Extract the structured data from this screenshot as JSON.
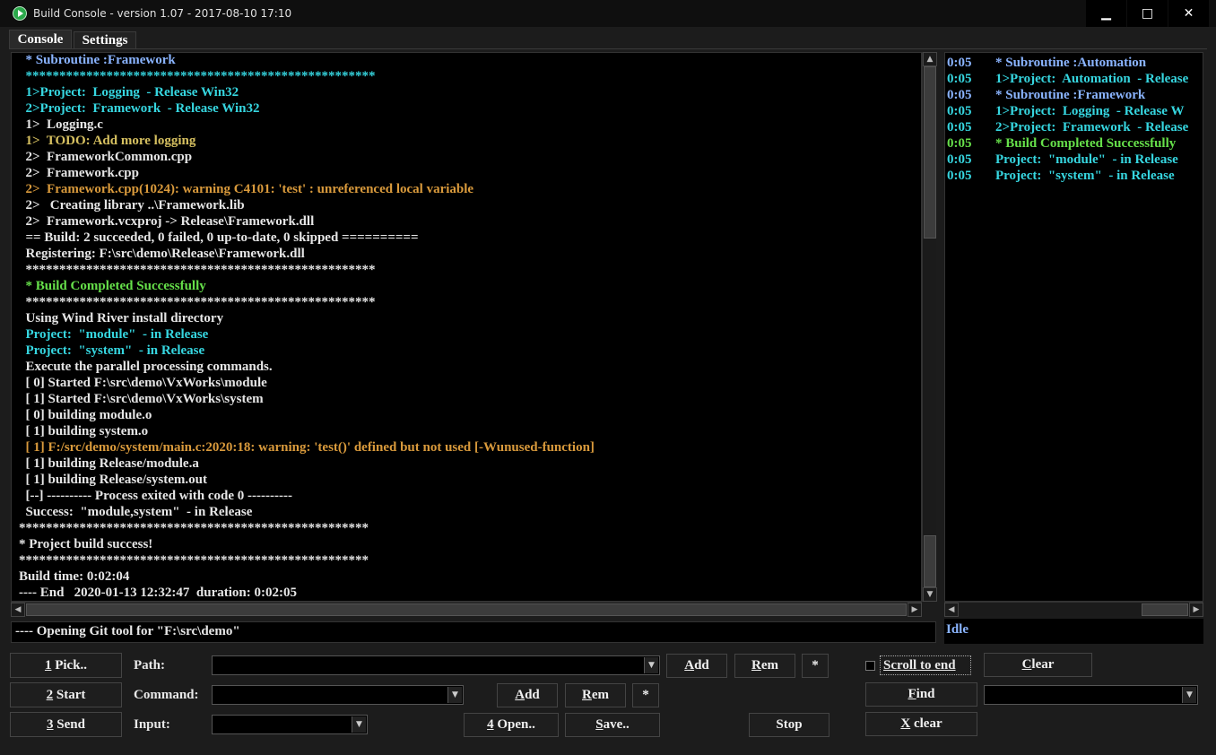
{
  "window": {
    "title": "Build Console - version 1.07 - 2017-08-10 17:10",
    "minimize": "▁",
    "maximize": "□",
    "close": "✕"
  },
  "tabs": [
    {
      "label": "Console"
    },
    {
      "label": "Settings"
    }
  ],
  "colors": {
    "white": "#e6e6e6",
    "blue": "#8ab4ff",
    "cyan": "#36d6e0",
    "yellow": "#d6c060",
    "orange": "#d99a3c",
    "green": "#66e04a"
  },
  "console_lines": [
    {
      "text": "  * Subroutine :Framework",
      "color": "blue"
    },
    {
      "text": "  ****************************************************",
      "color": "cyan"
    },
    {
      "text": "  1>Project:  Logging  - Release Win32",
      "color": "cyan"
    },
    {
      "text": "  2>Project:  Framework  - Release Win32",
      "color": "cyan"
    },
    {
      "text": "  1>  Logging.c",
      "color": "white"
    },
    {
      "text": "  1>  TODO: Add more logging",
      "color": "yellow"
    },
    {
      "text": "  2>  FrameworkCommon.cpp",
      "color": "white"
    },
    {
      "text": "  2>  Framework.cpp",
      "color": "white"
    },
    {
      "text": "  2>  Framework.cpp(1024): warning C4101: 'test' : unreferenced local variable",
      "color": "orange"
    },
    {
      "text": "  2>   Creating library ..\\Framework.lib",
      "color": "white"
    },
    {
      "text": "  2>  Framework.vcxproj -> Release\\Framework.dll",
      "color": "white"
    },
    {
      "text": "  == Build: 2 succeeded, 0 failed, 0 up-to-date, 0 skipped ==========",
      "color": "white"
    },
    {
      "text": "  Registering: F:\\src\\demo\\Release\\Framework.dll",
      "color": "white"
    },
    {
      "text": "  ****************************************************",
      "color": "white"
    },
    {
      "text": "  * Build Completed Successfully",
      "color": "green"
    },
    {
      "text": "  ****************************************************",
      "color": "white"
    },
    {
      "text": "  Using Wind River install directory",
      "color": "white"
    },
    {
      "text": "  Project:  \"module\"  - in Release",
      "color": "cyan"
    },
    {
      "text": "  Project:  \"system\"  - in Release",
      "color": "cyan"
    },
    {
      "text": "  Execute the parallel processing commands.",
      "color": "white"
    },
    {
      "text": "  [ 0] Started F:\\src\\demo\\VxWorks\\module",
      "color": "white"
    },
    {
      "text": "  [ 1] Started F:\\src\\demo\\VxWorks\\system",
      "color": "white"
    },
    {
      "text": "  [ 0] building module.o",
      "color": "white"
    },
    {
      "text": "  [ 1] building system.o",
      "color": "white"
    },
    {
      "text": "  [ 1] F:/src/demo/system/main.c:2020:18: warning: 'test()' defined but not used [-Wunused-function]",
      "color": "orange"
    },
    {
      "text": "  [ 1] building Release/module.a",
      "color": "white"
    },
    {
      "text": "  [ 1] building Release/system.out",
      "color": "white"
    },
    {
      "text": "  [--] ---------- Process exited with code 0 ----------",
      "color": "white"
    },
    {
      "text": "  Success:  \"module,system\"  - in Release",
      "color": "white"
    },
    {
      "text": "****************************************************",
      "color": "white"
    },
    {
      "text": "* Project build success!",
      "color": "white"
    },
    {
      "text": "****************************************************",
      "color": "white"
    },
    {
      "text": "Build time: 0:02:04",
      "color": "white"
    },
    {
      "text": "---- End   2020-01-13 12:32:47  duration: 0:02:05",
      "color": "white"
    }
  ],
  "summary_lines": [
    {
      "time": "0:05",
      "text": "* Subroutine :Automation",
      "color": "blue"
    },
    {
      "time": "0:05",
      "text": "1>Project:  Automation  - Release",
      "color": "cyan"
    },
    {
      "time": "0:05",
      "text": "* Subroutine :Framework",
      "color": "blue"
    },
    {
      "time": "0:05",
      "text": "1>Project:  Logging  - Release W",
      "color": "cyan"
    },
    {
      "time": "0:05",
      "text": "2>Project:  Framework  - Release",
      "color": "cyan"
    },
    {
      "time": "0:05",
      "text": "* Build Completed Successfully",
      "color": "green"
    },
    {
      "time": "0:05",
      "text": "Project:  \"module\"  - in Release",
      "color": "cyan"
    },
    {
      "time": "0:05",
      "text": "Project:  \"system\"  - in Release",
      "color": "cyan"
    }
  ],
  "status": {
    "message": "---- Opening Git tool for \"F:\\src\\demo\"",
    "state": "Idle"
  },
  "scroll": {
    "console_thumb_top_fraction": 0.0,
    "console_thumb_size_fraction": 0.33,
    "console_thumb2_top_fraction": 0.9
  },
  "controls": {
    "pick": {
      "num": "1",
      "rest": " Pick.."
    },
    "start": {
      "num": "2",
      "rest": " Start"
    },
    "send": {
      "num": "3",
      "rest": " Send"
    },
    "path_label": "Path:",
    "command_label": "Command:",
    "input_label": "Input:",
    "path_value": "",
    "command_value": "",
    "input_value": "",
    "add_path": {
      "num": "A",
      "rest": "dd"
    },
    "rem_path": {
      "num": "R",
      "rest": "em"
    },
    "star_path": "*",
    "add_cmd": {
      "num": "A",
      "rest": "dd"
    },
    "rem_cmd": {
      "num": "R",
      "rest": "em"
    },
    "star_cmd": "*",
    "open": {
      "num": "4",
      "rest": " Open.."
    },
    "save": {
      "num": "S",
      "rest": "ave.."
    },
    "stop": "Stop",
    "scroll_to_end": "Scroll to end",
    "scroll_to_end_checked": false,
    "clear": {
      "num": "C",
      "rest": "lear"
    },
    "find": {
      "num": "F",
      "rest": "ind"
    },
    "xclear": {
      "num": "X",
      "rest": " clear"
    },
    "find_value": ""
  }
}
